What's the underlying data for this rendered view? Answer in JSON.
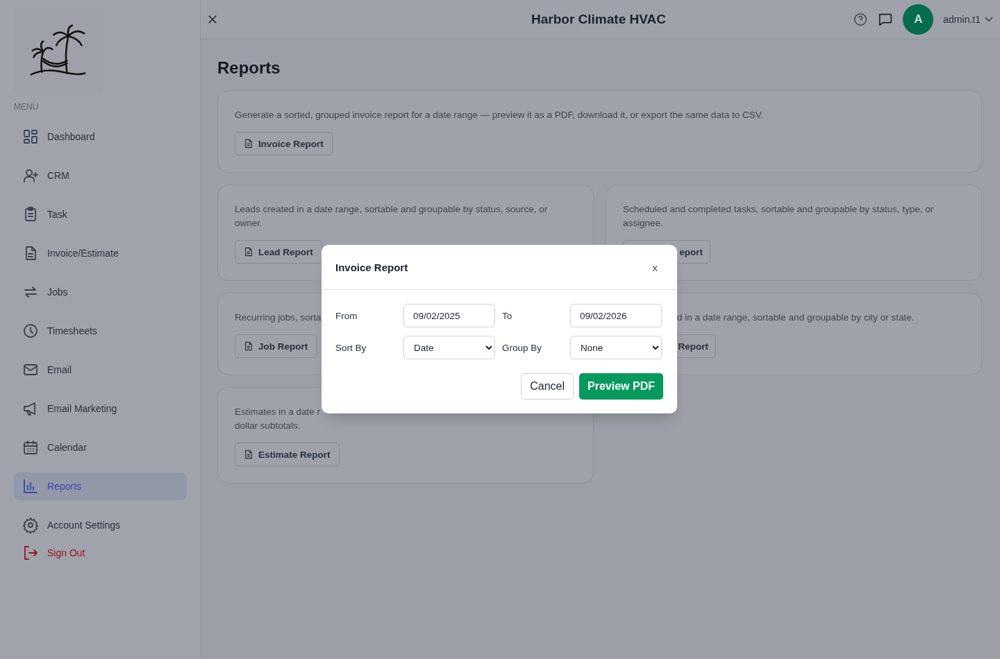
{
  "sidebar": {
    "menu_label": "MENU",
    "items": [
      {
        "label": "Dashboard",
        "selected": false
      },
      {
        "label": "CRM",
        "selected": false
      },
      {
        "label": "Task",
        "selected": false
      },
      {
        "label": "Invoice/Estimate",
        "selected": false
      },
      {
        "label": "Jobs",
        "selected": false
      },
      {
        "label": "Timesheets",
        "selected": false
      },
      {
        "label": "Email",
        "selected": false
      },
      {
        "label": "Email Marketing",
        "selected": false
      },
      {
        "label": "Calendar",
        "selected": false
      },
      {
        "label": "Reports",
        "selected": true
      },
      {
        "label": "Account Settings",
        "selected": false
      }
    ],
    "sign_out": "Sign Out"
  },
  "header": {
    "title": "Harbor Climate HVAC",
    "avatar": "A",
    "user": "admin.t1"
  },
  "page_title": "Reports",
  "cards": [
    {
      "description": [
        "Generate a sorted, grouped invoice report for a date range — preview it as a PDF, download it, or export the same data to CSV."
      ],
      "button": "Invoice Report"
    },
    {
      "description": [
        "Leads created in a date range, sortable and groupable by status, source, or",
        "owner."
      ],
      "button": "Lead Report"
    },
    {
      "description": [
        "Scheduled and completed tasks, sortable and groupable by status, type, or",
        "assignee."
      ],
      "button": "eport"
    },
    {
      "description": [
        "Recurring jobs, sorta"
      ],
      "button": "Job Report"
    },
    {
      "description": [
        "d in a date range, sortable and groupable by city or state."
      ],
      "button": "Report"
    },
    {
      "description": [
        "Estimates in a date r",
        "dollar subtotals."
      ],
      "button": "Estimate Report"
    }
  ],
  "modal": {
    "title": "Invoice Report",
    "close": "x",
    "fields": [
      {
        "label": "From",
        "value": "09/02/2025",
        "kind": "date"
      },
      {
        "label": "To",
        "value": "09/02/2026",
        "kind": "date"
      },
      {
        "label": "Sort By",
        "value": "Date",
        "kind": "select"
      },
      {
        "label": "Group By",
        "value": "None",
        "kind": "select"
      }
    ],
    "cancel": "Cancel",
    "confirm": "Preview PDF"
  }
}
